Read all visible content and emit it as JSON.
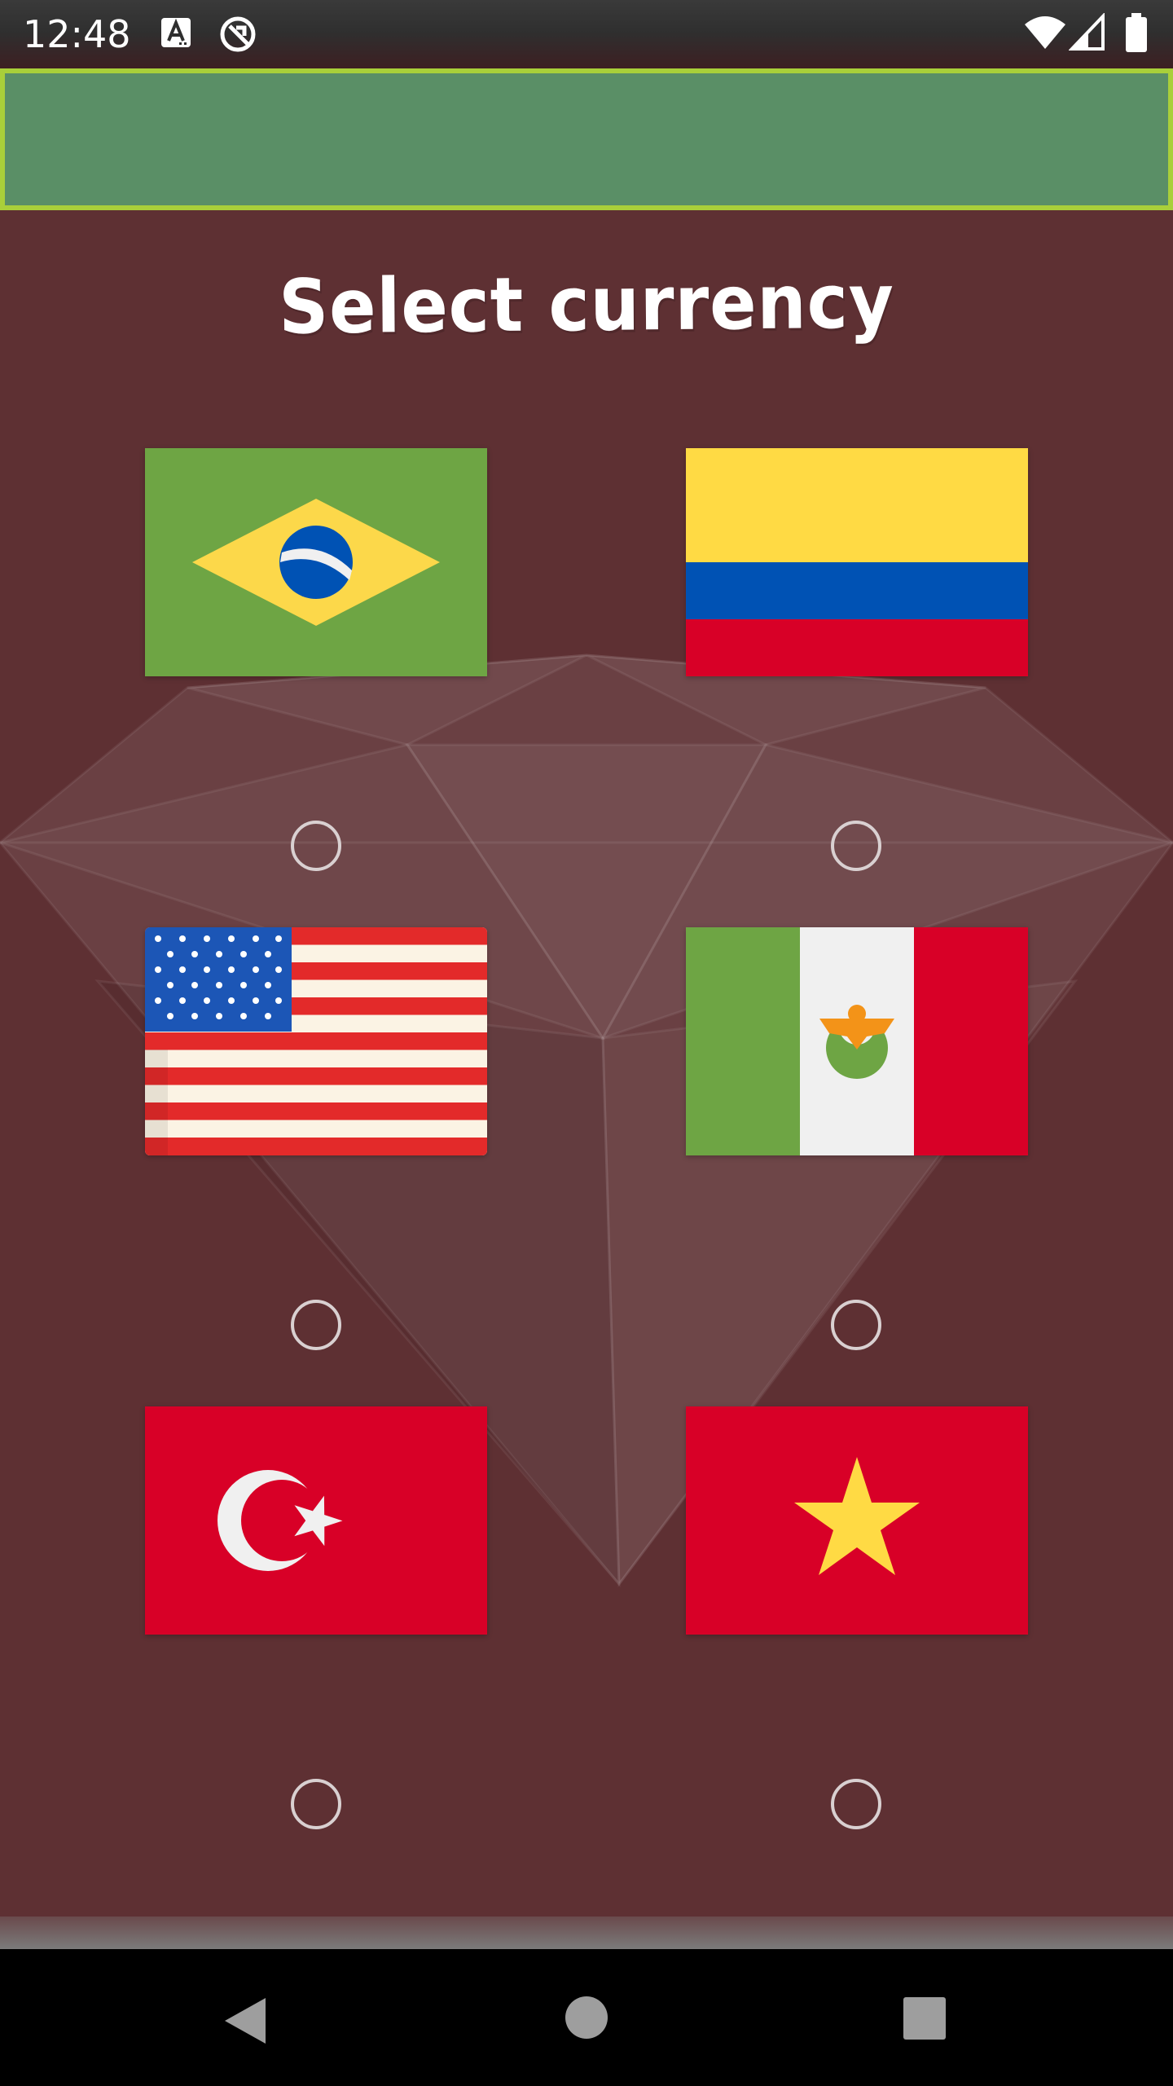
{
  "status_bar": {
    "time": "12:48",
    "left_icons": [
      "text-input-icon",
      "sync-disabled-icon"
    ],
    "right_icons": [
      "wifi-icon",
      "cellular-signal-icon",
      "battery-icon"
    ]
  },
  "screen": {
    "title": "Select currency"
  },
  "currencies": [
    {
      "country": "Brazil",
      "selected": false
    },
    {
      "country": "Colombia",
      "selected": false
    },
    {
      "country": "United States",
      "selected": false
    },
    {
      "country": "Mexico",
      "selected": false
    },
    {
      "country": "Turkey",
      "selected": false
    },
    {
      "country": "Vietnam",
      "selected": false
    }
  ],
  "nav_bar": {
    "buttons": [
      "back-icon",
      "home-icon",
      "recents-icon"
    ]
  },
  "colors": {
    "background": "#5e3033",
    "banner": "#5a8f66",
    "banner_border": "#a9cf3a",
    "title_text": "#ffffff"
  }
}
